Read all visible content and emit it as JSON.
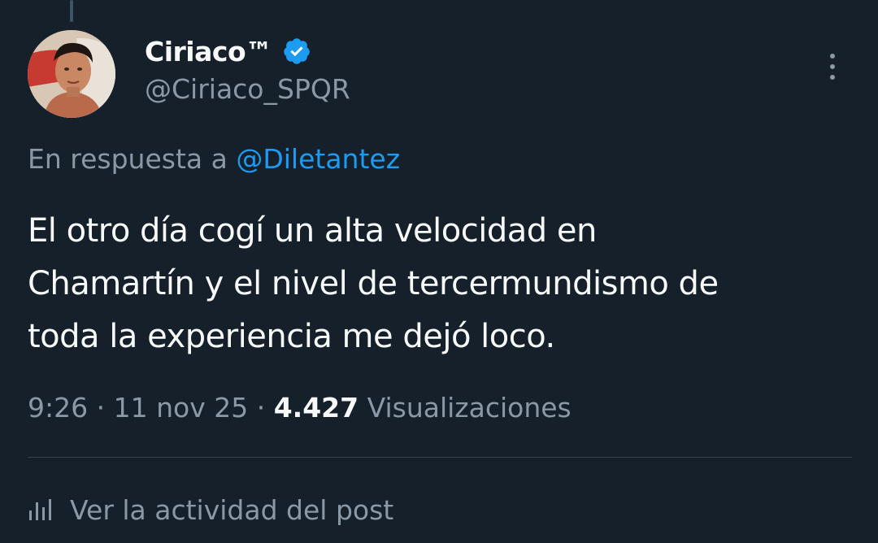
{
  "author": {
    "display_name": "Ciriaco™",
    "handle": "@Ciriaco_SPQR",
    "verified": true,
    "avatar_icon": "profile-photo"
  },
  "reply": {
    "prefix": "En respuesta a ",
    "mention": "@Diletantez"
  },
  "tweet": {
    "lines": [
      "El otro día cogí un alta velocidad en",
      "Chamartín y el nivel de tercermundismo de",
      "toda la experiencia me dejó loco."
    ]
  },
  "meta": {
    "time": "9:26",
    "separator": "·",
    "date": "11 nov 25",
    "views_count": "4.427",
    "views_label": "Visualizaciones"
  },
  "activity": {
    "label": "Ver la actividad del post",
    "icon": "analytics-icon"
  },
  "colors": {
    "background": "#15202b",
    "primary_text": "#f7f9f9",
    "secondary_text": "#8b98a5",
    "link": "#1d9bf0",
    "verified_badge": "#1d9bf0",
    "divider": "#38444d"
  }
}
